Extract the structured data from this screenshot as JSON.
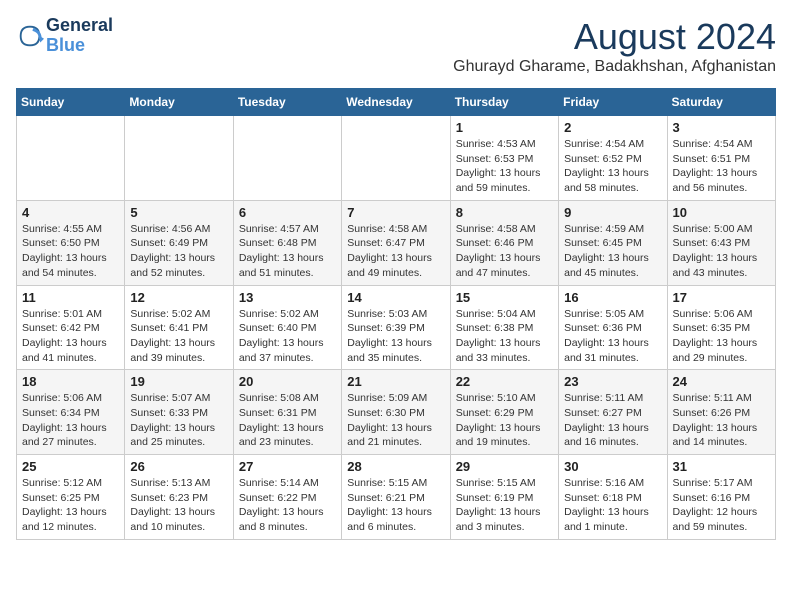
{
  "logo": {
    "line1": "General",
    "line2": "Blue"
  },
  "title": "August 2024",
  "subtitle": "Ghurayd Gharame, Badakhshan, Afghanistan",
  "weekdays": [
    "Sunday",
    "Monday",
    "Tuesday",
    "Wednesday",
    "Thursday",
    "Friday",
    "Saturday"
  ],
  "weeks": [
    [
      {
        "day": "",
        "info": ""
      },
      {
        "day": "",
        "info": ""
      },
      {
        "day": "",
        "info": ""
      },
      {
        "day": "",
        "info": ""
      },
      {
        "day": "1",
        "info": "Sunrise: 4:53 AM\nSunset: 6:53 PM\nDaylight: 13 hours\nand 59 minutes."
      },
      {
        "day": "2",
        "info": "Sunrise: 4:54 AM\nSunset: 6:52 PM\nDaylight: 13 hours\nand 58 minutes."
      },
      {
        "day": "3",
        "info": "Sunrise: 4:54 AM\nSunset: 6:51 PM\nDaylight: 13 hours\nand 56 minutes."
      }
    ],
    [
      {
        "day": "4",
        "info": "Sunrise: 4:55 AM\nSunset: 6:50 PM\nDaylight: 13 hours\nand 54 minutes."
      },
      {
        "day": "5",
        "info": "Sunrise: 4:56 AM\nSunset: 6:49 PM\nDaylight: 13 hours\nand 52 minutes."
      },
      {
        "day": "6",
        "info": "Sunrise: 4:57 AM\nSunset: 6:48 PM\nDaylight: 13 hours\nand 51 minutes."
      },
      {
        "day": "7",
        "info": "Sunrise: 4:58 AM\nSunset: 6:47 PM\nDaylight: 13 hours\nand 49 minutes."
      },
      {
        "day": "8",
        "info": "Sunrise: 4:58 AM\nSunset: 6:46 PM\nDaylight: 13 hours\nand 47 minutes."
      },
      {
        "day": "9",
        "info": "Sunrise: 4:59 AM\nSunset: 6:45 PM\nDaylight: 13 hours\nand 45 minutes."
      },
      {
        "day": "10",
        "info": "Sunrise: 5:00 AM\nSunset: 6:43 PM\nDaylight: 13 hours\nand 43 minutes."
      }
    ],
    [
      {
        "day": "11",
        "info": "Sunrise: 5:01 AM\nSunset: 6:42 PM\nDaylight: 13 hours\nand 41 minutes."
      },
      {
        "day": "12",
        "info": "Sunrise: 5:02 AM\nSunset: 6:41 PM\nDaylight: 13 hours\nand 39 minutes."
      },
      {
        "day": "13",
        "info": "Sunrise: 5:02 AM\nSunset: 6:40 PM\nDaylight: 13 hours\nand 37 minutes."
      },
      {
        "day": "14",
        "info": "Sunrise: 5:03 AM\nSunset: 6:39 PM\nDaylight: 13 hours\nand 35 minutes."
      },
      {
        "day": "15",
        "info": "Sunrise: 5:04 AM\nSunset: 6:38 PM\nDaylight: 13 hours\nand 33 minutes."
      },
      {
        "day": "16",
        "info": "Sunrise: 5:05 AM\nSunset: 6:36 PM\nDaylight: 13 hours\nand 31 minutes."
      },
      {
        "day": "17",
        "info": "Sunrise: 5:06 AM\nSunset: 6:35 PM\nDaylight: 13 hours\nand 29 minutes."
      }
    ],
    [
      {
        "day": "18",
        "info": "Sunrise: 5:06 AM\nSunset: 6:34 PM\nDaylight: 13 hours\nand 27 minutes."
      },
      {
        "day": "19",
        "info": "Sunrise: 5:07 AM\nSunset: 6:33 PM\nDaylight: 13 hours\nand 25 minutes."
      },
      {
        "day": "20",
        "info": "Sunrise: 5:08 AM\nSunset: 6:31 PM\nDaylight: 13 hours\nand 23 minutes."
      },
      {
        "day": "21",
        "info": "Sunrise: 5:09 AM\nSunset: 6:30 PM\nDaylight: 13 hours\nand 21 minutes."
      },
      {
        "day": "22",
        "info": "Sunrise: 5:10 AM\nSunset: 6:29 PM\nDaylight: 13 hours\nand 19 minutes."
      },
      {
        "day": "23",
        "info": "Sunrise: 5:11 AM\nSunset: 6:27 PM\nDaylight: 13 hours\nand 16 minutes."
      },
      {
        "day": "24",
        "info": "Sunrise: 5:11 AM\nSunset: 6:26 PM\nDaylight: 13 hours\nand 14 minutes."
      }
    ],
    [
      {
        "day": "25",
        "info": "Sunrise: 5:12 AM\nSunset: 6:25 PM\nDaylight: 13 hours\nand 12 minutes."
      },
      {
        "day": "26",
        "info": "Sunrise: 5:13 AM\nSunset: 6:23 PM\nDaylight: 13 hours\nand 10 minutes."
      },
      {
        "day": "27",
        "info": "Sunrise: 5:14 AM\nSunset: 6:22 PM\nDaylight: 13 hours\nand 8 minutes."
      },
      {
        "day": "28",
        "info": "Sunrise: 5:15 AM\nSunset: 6:21 PM\nDaylight: 13 hours\nand 6 minutes."
      },
      {
        "day": "29",
        "info": "Sunrise: 5:15 AM\nSunset: 6:19 PM\nDaylight: 13 hours\nand 3 minutes."
      },
      {
        "day": "30",
        "info": "Sunrise: 5:16 AM\nSunset: 6:18 PM\nDaylight: 13 hours\nand 1 minute."
      },
      {
        "day": "31",
        "info": "Sunrise: 5:17 AM\nSunset: 6:16 PM\nDaylight: 12 hours\nand 59 minutes."
      }
    ]
  ]
}
